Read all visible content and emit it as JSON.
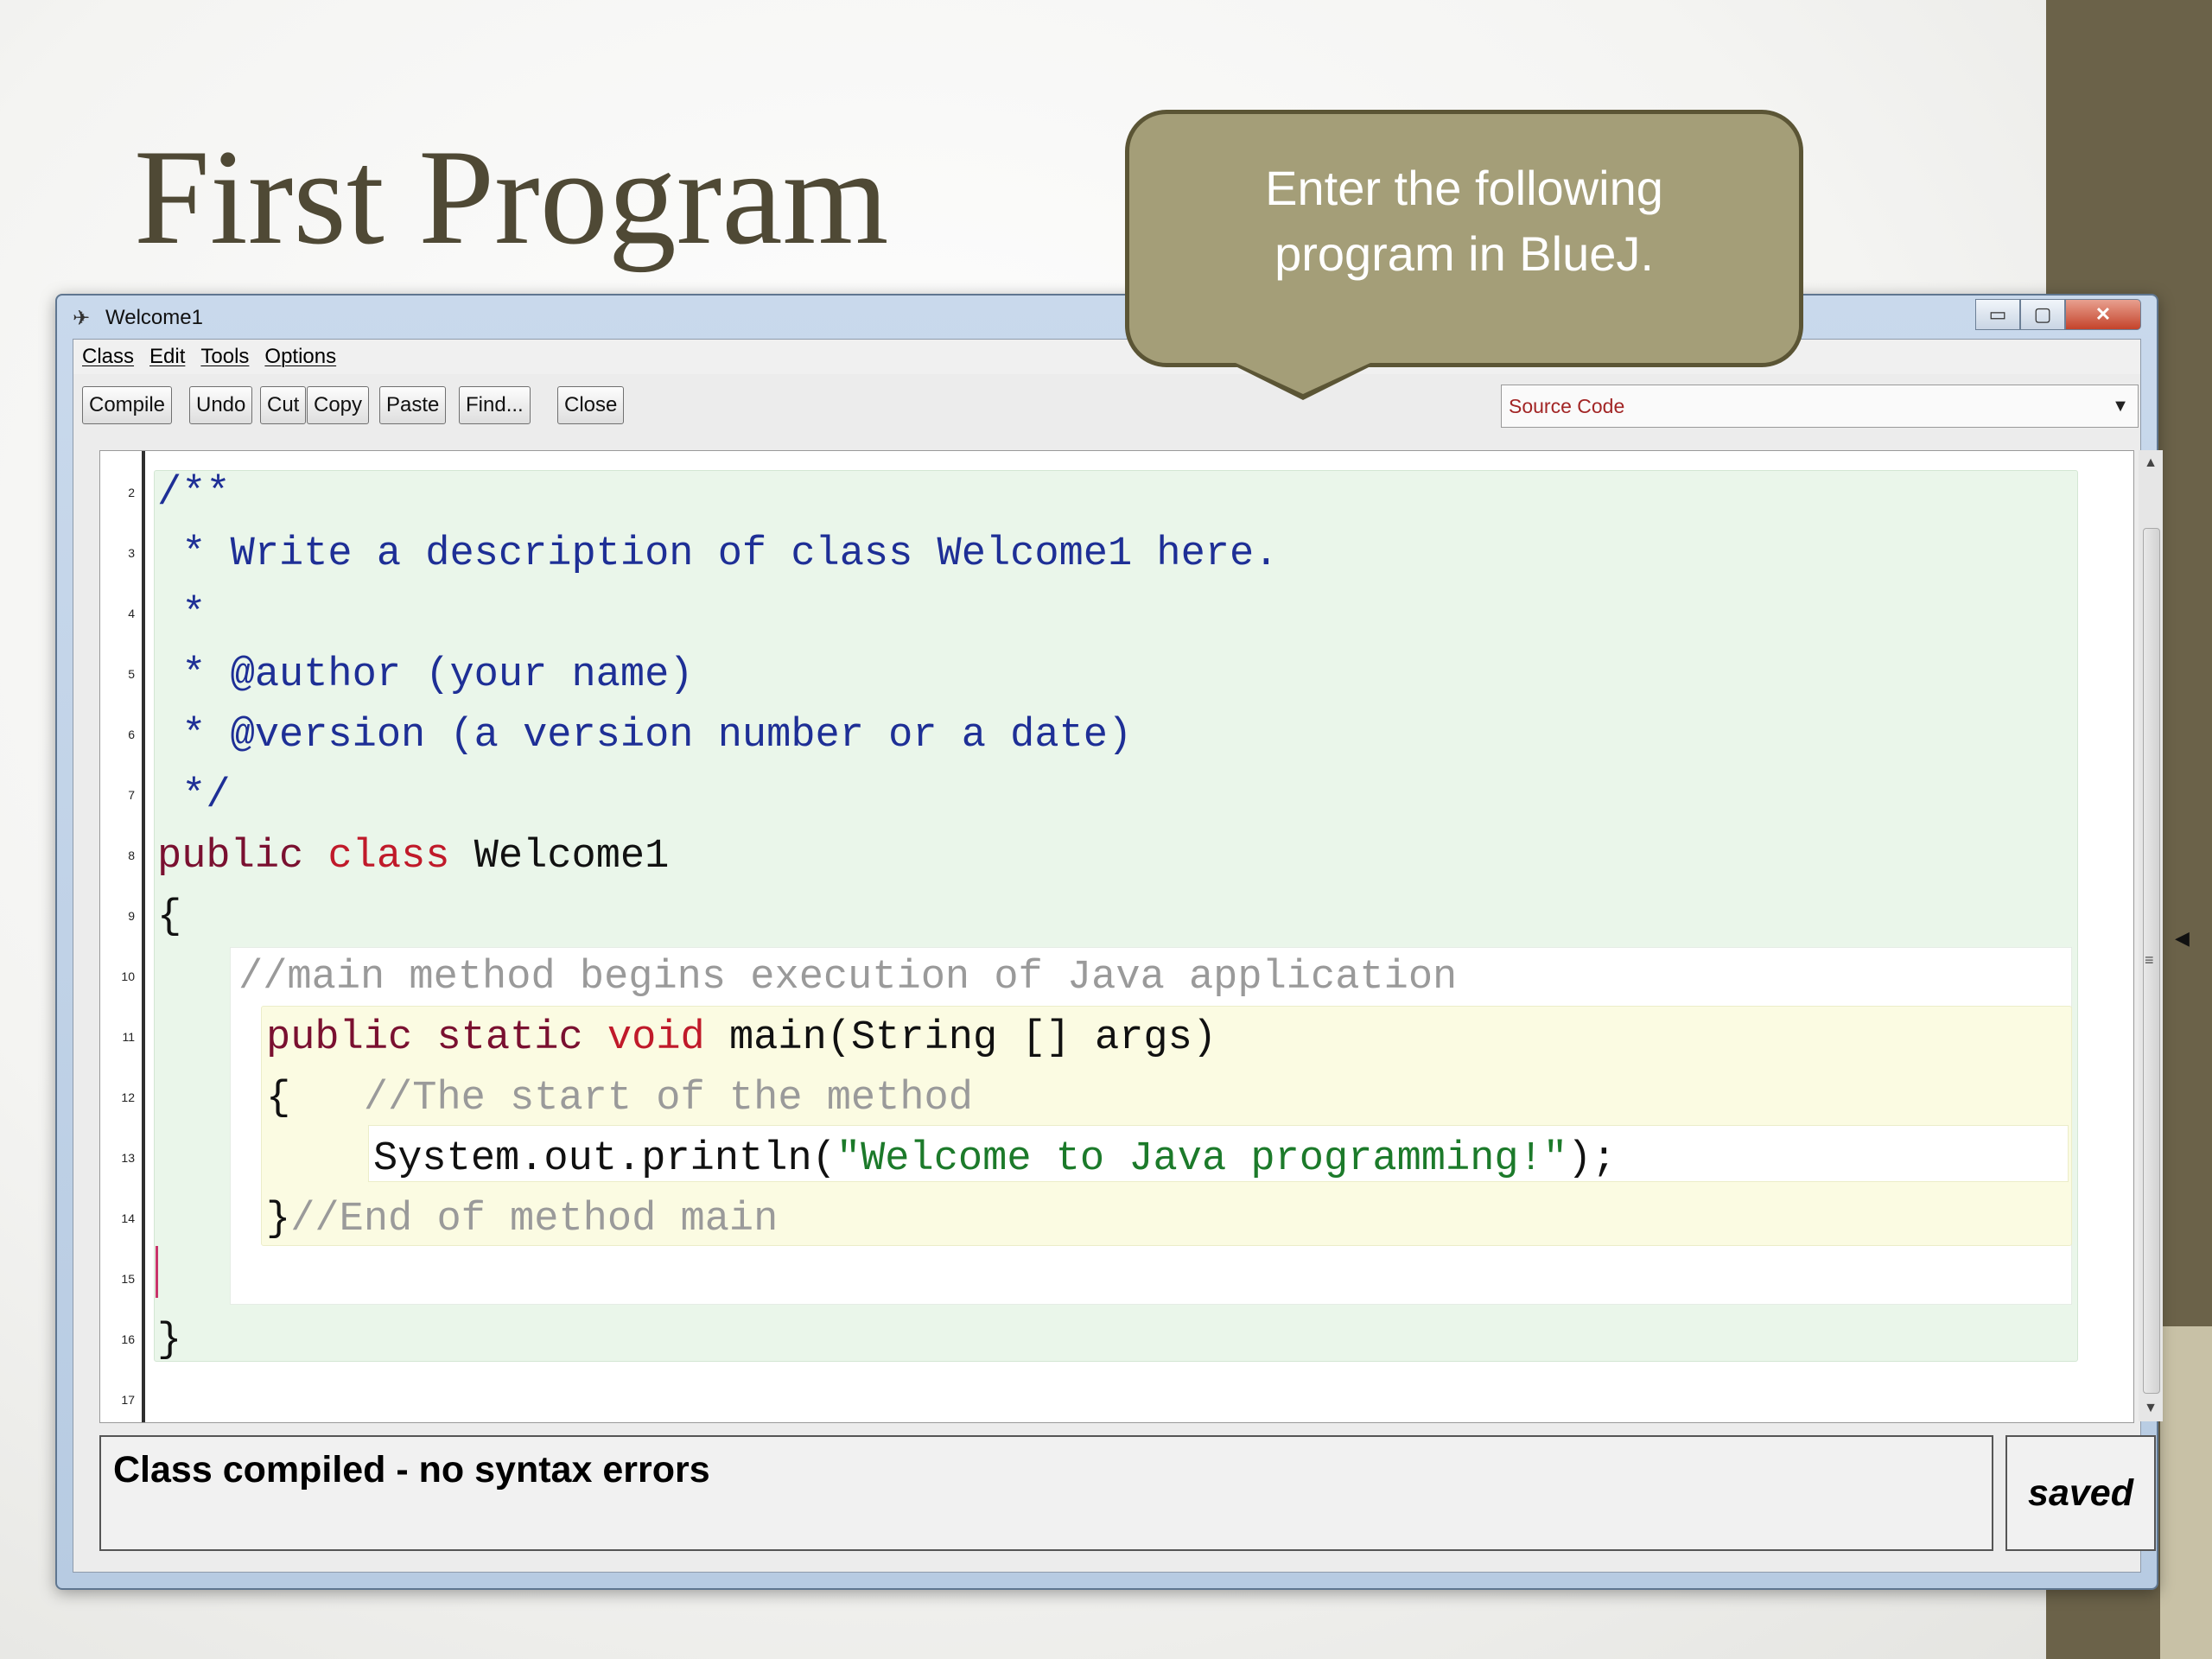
{
  "slide": {
    "title": "First Program"
  },
  "callout": {
    "line1": "Enter the following",
    "line2": "program in BlueJ."
  },
  "window": {
    "title": "Welcome1",
    "controls": {
      "minimize": "▭",
      "maximize": "▢",
      "close": "✕"
    },
    "menu": [
      "Class",
      "Edit",
      "Tools",
      "Options"
    ],
    "toolbar": [
      "Compile",
      "Undo",
      "Cut",
      "Copy",
      "Paste",
      "Find...",
      "Close"
    ],
    "view_selector": "Source Code"
  },
  "editor": {
    "line_numbers": [
      "2",
      "3",
      "4",
      "5",
      "6",
      "7",
      "8",
      "9",
      "10",
      "11",
      "12",
      "13",
      "14",
      "15",
      "16",
      "17"
    ],
    "code": {
      "l2": "/**",
      "l3": " * Write a description of class Welcome1 here.",
      "l4": " *",
      "l5": " * @author (your name)",
      "l6": " * @version (a version number or a date)",
      "l7": " */",
      "l8_kw1": "public",
      "l8_kw2": "class",
      "l8_name": "Welcome1",
      "l9": "{",
      "l10": "//main method begins execution of Java application",
      "l11_kw1": "public",
      "l11_kw2": "static",
      "l11_kw3": "void",
      "l11_rest": "main(String [] args)",
      "l12_brace": "{",
      "l12_comment": "//The start of the method",
      "l13_call": "System.out.println(",
      "l13_string": "\"Welcome to Java programming!\"",
      "l13_end": ");",
      "l14_brace": "}",
      "l14_comment": "//End of method main",
      "l16": "}"
    }
  },
  "status": {
    "message": "Class compiled - no syntax errors",
    "saved": "saved"
  },
  "colors": {
    "accent_band": "#6b6249",
    "callout_fill": "#a49e78",
    "comment": "#1e2f96",
    "keyword": "#7a1030",
    "string": "#1c7a2a"
  }
}
